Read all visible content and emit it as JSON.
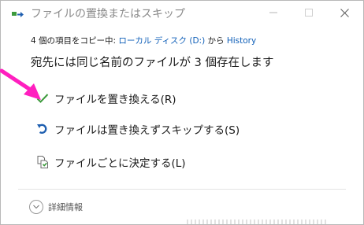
{
  "window": {
    "title": "ファイルの置換またはスキップ",
    "controls": {
      "minimize": "minimize-icon",
      "maximize": "maximize-icon",
      "close": "close-icon"
    }
  },
  "copy_status": {
    "prefix": "4 個の項目をコピー中: ",
    "source": "ローカル ディスク (D:)",
    "middle": " から ",
    "destination": "History"
  },
  "heading": "宛先には同じ名前のファイルが 3 個存在します",
  "options": [
    {
      "label": "ファイルを置き換える(R)",
      "icon": "checkmark-icon",
      "color": "#3c9a3c"
    },
    {
      "label": "ファイルは置き換えずスキップする(S)",
      "icon": "skip-arrow-icon",
      "color": "#1f5fb0"
    },
    {
      "label": "ファイルごとに決定する(L)",
      "icon": "file-compare-icon",
      "color": "#3c9a3c"
    }
  ],
  "details": {
    "label": "詳細情報",
    "icon": "chevron-down-icon"
  },
  "colors": {
    "link": "#0f5fb8",
    "annotation_arrow": "#ff1fbf"
  }
}
